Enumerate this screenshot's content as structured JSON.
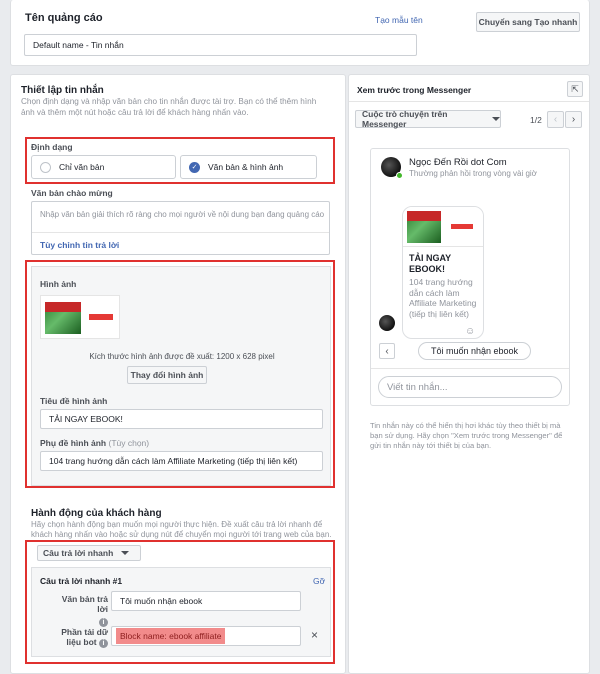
{
  "top": {
    "title": "Tên quảng cáo",
    "template_link": "Tạo mẫu tên",
    "switch_button": "Chuyển sang Tạo nhanh",
    "name_value": "Default name - Tin nhắn"
  },
  "setup": {
    "title": "Thiết lập tin nhắn",
    "desc": "Chọn định dạng và nhập văn bản cho tin nhắn được tài trợ. Bạn có thể thêm hình ảnh và thêm một nút hoặc câu trả lời để khách hàng nhấn vào.",
    "format_label": "Định dạng",
    "format_text_only": "Chỉ văn bản",
    "format_text_image": "Văn bản & hình ảnh",
    "greeting_label": "Văn bản chào mừng",
    "greeting_placeholder": "Nhập văn bản giải thích rõ ràng cho mọi người về nội dung bạn đang quảng cáo",
    "custom_reply_link": "Tùy chỉnh tin trả lời"
  },
  "image": {
    "label": "Hình ảnh",
    "size_hint": "Kích thước hình ảnh được đề xuất: 1200 x 628 pixel",
    "change_button": "Thay đổi hình ảnh",
    "title_label": "Tiêu đề hình ảnh",
    "title_value": "TẢI NGAY EBOOK!",
    "subtitle_label": "Phụ đề hình ảnh",
    "subtitle_optional": "(Tùy chọn)",
    "subtitle_value": "104 trang hướng dẫn cách làm Affiliate Marketing (tiếp thị liên kết)"
  },
  "action": {
    "title": "Hành động của khách hàng",
    "desc": "Hãy chọn hành động bạn muốn mọi người thực hiện. Đề xuất câu trả lời nhanh để khách hàng nhấn vào hoặc sử dụng nút để chuyển mọi người tới trang web của bạn.",
    "type_button": "Câu trả lời nhanh",
    "quick_reply_title": "Câu trả lời nhanh #1",
    "remove_link": "Gỡ",
    "reply_text_label": "Văn bản trả lời",
    "reply_text_value": "Tôi muốn nhận ebook",
    "bot_payload_label_1": "Phần tải dữ",
    "bot_payload_label_2": "liệu bot",
    "bot_payload_value": "Block name: ebook affiliate"
  },
  "preview": {
    "title": "Xem trước trong Messenger",
    "mode_select": "Cuộc trò chuyện trên Messenger",
    "pager": "1/2",
    "page_name": "Ngọc Đến Rồi dot Com",
    "page_status": "Thường phản hồi trong vòng vài giờ",
    "card_title": "TẢI NGAY EBOOK!",
    "card_sub": "104 trang hướng dẫn cách làm Affiliate Marketing (tiếp thị liên kết)",
    "quick_reply_chip": "Tôi muốn nhận ebook",
    "composer_placeholder": "Viết tin nhắn...",
    "footnote": "Tin nhắn này có thể hiển thị hơi khác tùy theo thiết bị mà bạn sử dụng. Hãy chọn \"Xem trước trong Messenger\" để gửi tin nhắn này tới thiết bị của bạn."
  },
  "colors": {
    "accent": "#4267b2",
    "highlight": "#e0312f",
    "payload_bg": "#f28b8b"
  }
}
